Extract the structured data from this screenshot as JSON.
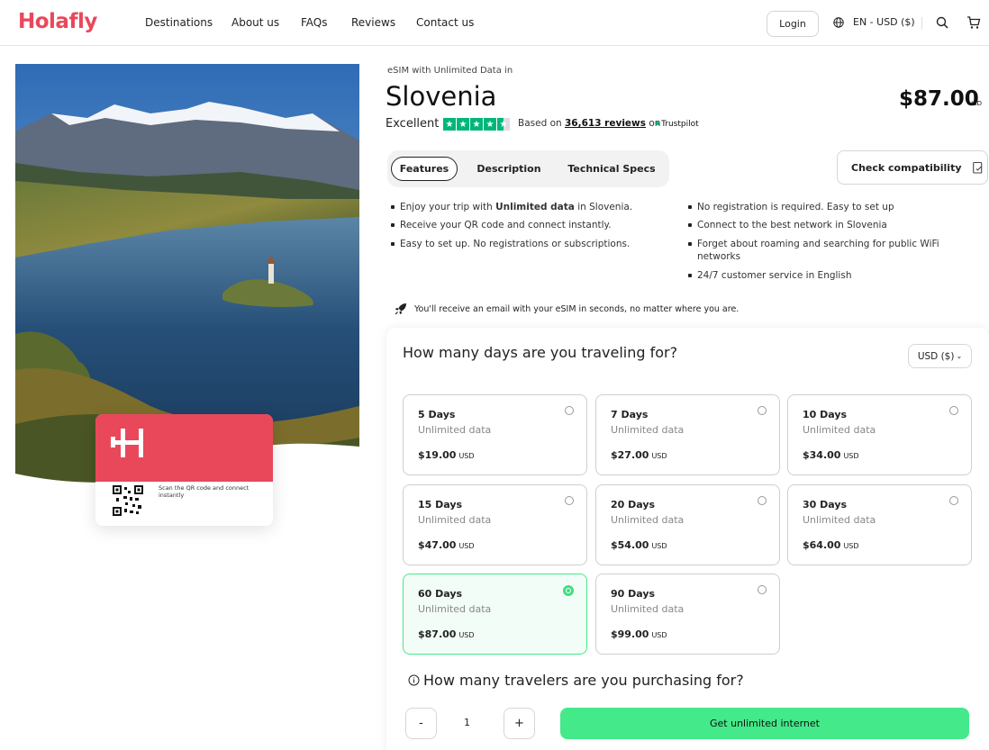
{
  "header": {
    "logo": "Holafly",
    "nav": [
      "Destinations",
      "About us",
      "FAQs",
      "Reviews",
      "Contact us"
    ],
    "login": "Login",
    "language": "EN - USD ($)"
  },
  "card": {
    "scan_text": "Scan the QR code and connect instantly"
  },
  "product": {
    "subtitle": "eSIM with Unlimited Data in",
    "country": "Slovenia",
    "price": "$87.00",
    "currency": "USD",
    "rating_label": "Excellent",
    "reviews_prefix": "Based on",
    "reviews_count": "36,613 reviews",
    "reviews_on": "on",
    "trustpilot": "Trustpilot"
  },
  "tabs": [
    "Features",
    "Description",
    "Technical Specs"
  ],
  "compatibility": "Check compatibility",
  "features_left": [
    [
      "Enjoy your trip with ",
      "Unlimited data",
      " in Slovenia."
    ],
    "Receive your QR code and connect instantly.",
    "Easy to set up. No registrations or subscriptions."
  ],
  "features_right": [
    "No registration is required. Easy to set up",
    "Connect to the best network in Slovenia",
    "Forget about roaming and searching for public WiFi networks",
    "24/7 customer service in English"
  ],
  "email_note": "You'll receive an email with your eSIM in seconds, no matter where you are.",
  "plans": {
    "question": "How many days are you traveling for?",
    "currency_select": "USD ($)",
    "data_label": "Unlimited data",
    "currency": "USD",
    "options": [
      {
        "days": "5 Days",
        "price": "$19.00"
      },
      {
        "days": "7 Days",
        "price": "$27.00"
      },
      {
        "days": "10 Days",
        "price": "$34.00"
      },
      {
        "days": "15 Days",
        "price": "$47.00"
      },
      {
        "days": "20 Days",
        "price": "$54.00"
      },
      {
        "days": "30 Days",
        "price": "$64.00"
      },
      {
        "days": "60 Days",
        "price": "$87.00"
      },
      {
        "days": "90 Days",
        "price": "$99.00"
      }
    ],
    "selected_index": 6
  },
  "travelers": {
    "question": "How many travelers are you purchasing for?",
    "minus": "-",
    "plus": "+",
    "quantity": "1",
    "cta": "Get unlimited internet"
  },
  "colors": {
    "brand": "#e9485b",
    "accent_green": "#44e98a",
    "trustpilot": "#00b67a"
  }
}
